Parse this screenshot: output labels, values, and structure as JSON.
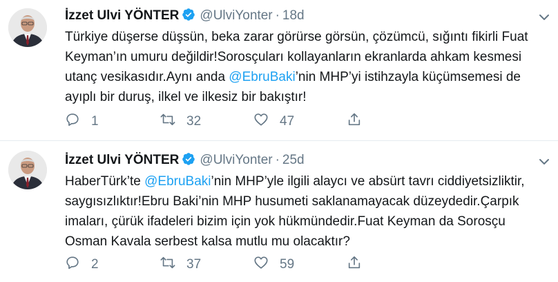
{
  "tweets": [
    {
      "name": "İzzet Ulvi YÖNTER",
      "handle": "@UlviYonter",
      "time": "18d",
      "text_parts": [
        "Türkiye düşerse düşsün, beka zarar görürse görsün, çözümcü, sığıntı fikirli Fuat Keyman’ın umuru değildir!Sorosçuları kollayanların ekranlarda ahkam kesmesi utanç vesikasıdır.Aynı anda ",
        "@EbruBaki",
        "’nin MHP’yi istihzayla küçümsemesi de ayıplı bir duruş, ilkel ve ilkesiz bir bakıştır!"
      ],
      "replies": "1",
      "retweets": "32",
      "likes": "47"
    },
    {
      "name": "İzzet Ulvi YÖNTER",
      "handle": "@UlviYonter",
      "time": "25d",
      "text_parts": [
        "HaberTürk’te ",
        "@EbruBaki",
        "’nin MHP’yle ilgili alaycı ve absürt tavrı ciddiyetsizliktir, saygısızlıktır!Ebru Baki’nin MHP husumeti saklanamayacak düzeydedir.Çarpık imaları, çürük ifadeleri bizim için yok hükmündedir.Fuat Keyman da Sorosçu Osman Kavala serbest kalsa mutlu mu olacaktır?"
      ],
      "replies": "2",
      "retweets": "37",
      "likes": "59"
    }
  ],
  "colors": {
    "accent": "#1da1f2",
    "muted": "#657786",
    "text": "#14171a",
    "divider": "#e6ecf0"
  },
  "icons": [
    "verified-icon",
    "chevron-down-icon",
    "reply-icon",
    "retweet-icon",
    "like-icon",
    "share-icon"
  ]
}
